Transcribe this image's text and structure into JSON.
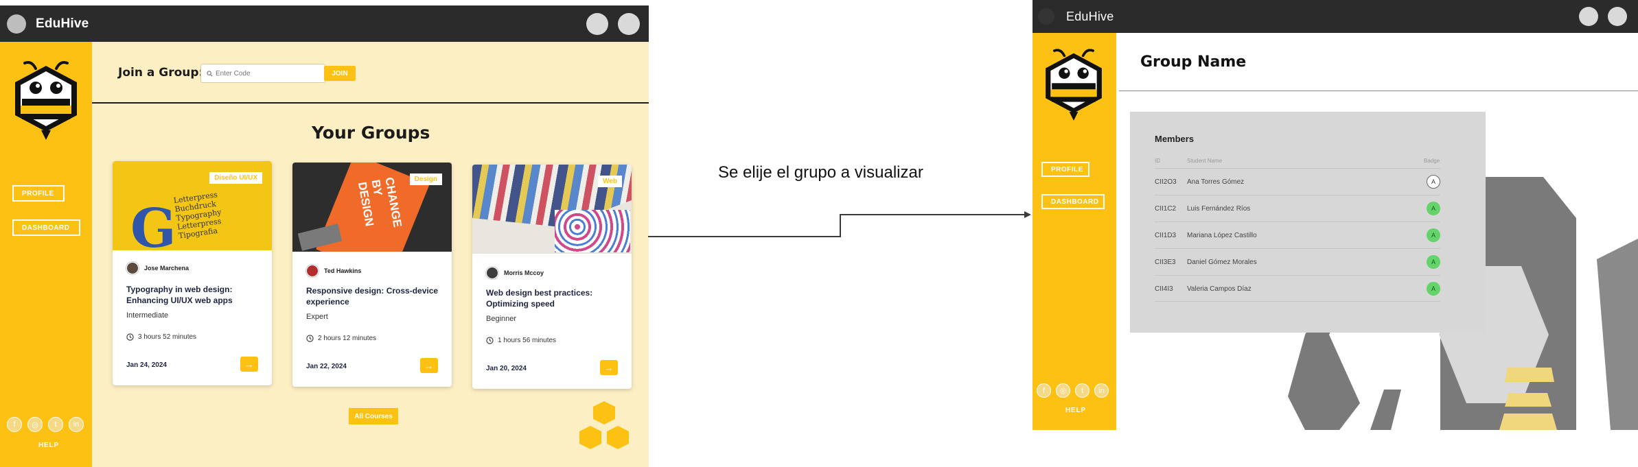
{
  "left_window": {
    "app_title": "EduHive",
    "sidebar": {
      "profile_label": "PROFILE",
      "dashboard_label": "DASHBOARD",
      "social_icons": [
        "facebook-icon",
        "instagram-icon",
        "twitter-icon",
        "linkedin-icon"
      ],
      "help_label": "HELP"
    },
    "join": {
      "label": "Join a Group:",
      "placeholder": "Enter Code",
      "button_label": "JOIN"
    },
    "section_title": "Your Groups",
    "cards": [
      {
        "tag": "Diseño UI/UX",
        "author": "Jose Marchena",
        "title": "Typography in web design: Enhancing UI/UX web apps",
        "level": "Intermediate",
        "duration": "3 hours 52 minutes",
        "date": "Jan 24, 2024",
        "arrow": "→"
      },
      {
        "tag": "Design",
        "author": "Ted Hawkins",
        "title": "Responsive design: Cross-device experience",
        "level": "Expert",
        "duration": "2 hours 12 minutes",
        "date": "Jan 22, 2024",
        "arrow": "→"
      },
      {
        "tag": "Web",
        "author": "Morris Mccoy",
        "title": "Web design best practices: Optimizing speed",
        "level": "Beginner",
        "duration": "1 hours 56 minutes",
        "date": "Jan 20, 2024",
        "arrow": "→"
      }
    ],
    "all_courses_label": "All Courses",
    "card_images": {
      "card1": "Letterpress Buchdruck Typography Letterpress Tipografia",
      "card2": "CHANGE BY DESIGN"
    }
  },
  "annotation": "Se elije el grupo a visualizar",
  "right_window": {
    "app_title": "EduHive",
    "sidebar": {
      "profile_label": "PROFILE",
      "dashboard_label": "DASHBOARD",
      "social_icons": [
        "facebook-icon",
        "instagram-icon",
        "twitter-icon",
        "linkedin-icon"
      ],
      "help_label": "HELP"
    },
    "page_title": "Group Name",
    "members": {
      "title": "Members",
      "headers": {
        "id": "ID",
        "name": "Student Name",
        "badge": "Badge"
      },
      "rows": [
        {
          "id": "CII2O3",
          "name": "Ana Torres Gómez",
          "badge": "A",
          "badge_style": "outline"
        },
        {
          "id": "CII1C2",
          "name": "Luis Fernández Ríos",
          "badge": "A",
          "badge_style": "green"
        },
        {
          "id": "CII1D3",
          "name": "Mariana López Castillo",
          "badge": "A",
          "badge_style": "green"
        },
        {
          "id": "CII3E3",
          "name": "Daniel Gómez Morales",
          "badge": "A",
          "badge_style": "green"
        },
        {
          "id": "CII4I3",
          "name": "Valeria Campos Díaz",
          "badge": "A",
          "badge_style": "green"
        }
      ]
    }
  },
  "colors": {
    "brand_yellow": "#fdc114",
    "titlebar": "#2b2b2b",
    "left_main_bg": "#fdefc4",
    "panel_gray": "#d7d7d7",
    "badge_green": "#63d36a"
  }
}
